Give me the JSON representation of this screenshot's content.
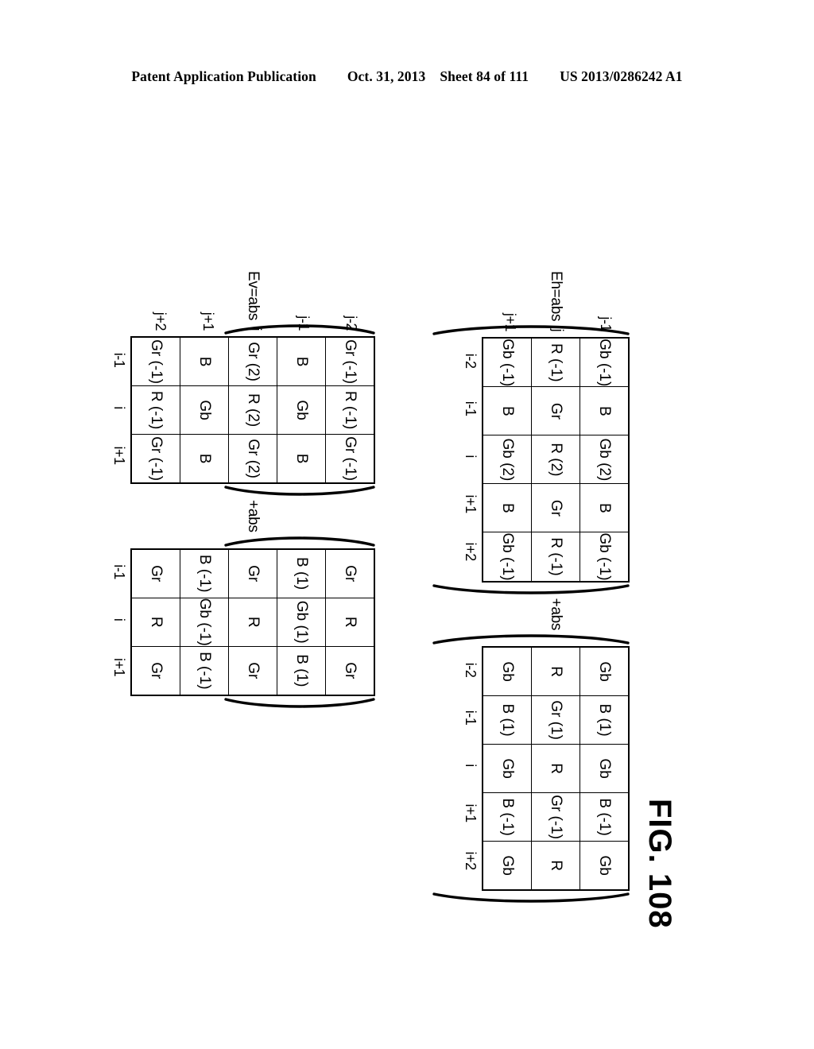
{
  "header": {
    "publication": "Patent Application Publication",
    "date": "Oct. 31, 2013",
    "sheet": "Sheet 84 of 111",
    "patent_number": "US 2013/0286242 A1"
  },
  "figure": {
    "label": "FIG. 108"
  },
  "equations": [
    {
      "id": "eh",
      "lead": "Eh=abs",
      "joiner": "+abs",
      "open_paren": "(",
      "close_paren": ")",
      "terms": [
        {
          "id": "eh-term-1",
          "row_labels": [
            "j-1",
            "j",
            "j+1"
          ],
          "col_labels": [
            "i-2",
            "i-1",
            "i",
            "i+1",
            "i+2"
          ],
          "cells": [
            [
              {
                "channel": "Gb",
                "coef": "(-1)"
              },
              {
                "channel": "B",
                "coef": ""
              },
              {
                "channel": "Gb",
                "coef": "(2)"
              },
              {
                "channel": "B",
                "coef": ""
              },
              {
                "channel": "Gb",
                "coef": "(-1)"
              }
            ],
            [
              {
                "channel": "R",
                "coef": "(-1)"
              },
              {
                "channel": "Gr",
                "coef": ""
              },
              {
                "channel": "R",
                "coef": "(2)"
              },
              {
                "channel": "Gr",
                "coef": ""
              },
              {
                "channel": "R",
                "coef": "(-1)"
              }
            ],
            [
              {
                "channel": "Gb",
                "coef": "(-1)"
              },
              {
                "channel": "B",
                "coef": ""
              },
              {
                "channel": "Gb",
                "coef": "(2)"
              },
              {
                "channel": "B",
                "coef": ""
              },
              {
                "channel": "Gb",
                "coef": "(-1)"
              }
            ]
          ]
        },
        {
          "id": "eh-term-2",
          "row_labels": [
            "j-1",
            "j",
            "j+1"
          ],
          "col_labels": [
            "i-2",
            "i-1",
            "i",
            "i+1",
            "i+2"
          ],
          "cells": [
            [
              {
                "channel": "Gb",
                "coef": ""
              },
              {
                "channel": "B",
                "coef": "(1)"
              },
              {
                "channel": "Gb",
                "coef": ""
              },
              {
                "channel": "B",
                "coef": "(-1)"
              },
              {
                "channel": "Gb",
                "coef": ""
              }
            ],
            [
              {
                "channel": "R",
                "coef": ""
              },
              {
                "channel": "Gr",
                "coef": "(1)"
              },
              {
                "channel": "R",
                "coef": ""
              },
              {
                "channel": "Gr",
                "coef": "(-1)"
              },
              {
                "channel": "R",
                "coef": ""
              }
            ],
            [
              {
                "channel": "Gb",
                "coef": ""
              },
              {
                "channel": "B",
                "coef": "(1)"
              },
              {
                "channel": "Gb",
                "coef": ""
              },
              {
                "channel": "B",
                "coef": "(-1)"
              },
              {
                "channel": "Gb",
                "coef": ""
              }
            ]
          ]
        }
      ]
    },
    {
      "id": "ev",
      "lead": "Ev=abs",
      "joiner": "+abs",
      "open_paren": "(",
      "close_paren": ")",
      "terms": [
        {
          "id": "ev-term-1",
          "row_labels": [
            "j-2",
            "j-1",
            "j",
            "j+1",
            "j+2"
          ],
          "col_labels": [
            "i-1",
            "i",
            "i+1"
          ],
          "cells": [
            [
              {
                "channel": "Gr",
                "coef": "(-1)"
              },
              {
                "channel": "R",
                "coef": "(-1)"
              },
              {
                "channel": "Gr",
                "coef": "(-1)"
              }
            ],
            [
              {
                "channel": "B",
                "coef": ""
              },
              {
                "channel": "Gb",
                "coef": ""
              },
              {
                "channel": "B",
                "coef": ""
              }
            ],
            [
              {
                "channel": "Gr",
                "coef": "(2)"
              },
              {
                "channel": "R",
                "coef": "(2)"
              },
              {
                "channel": "Gr",
                "coef": "(2)"
              }
            ],
            [
              {
                "channel": "B",
                "coef": ""
              },
              {
                "channel": "Gb",
                "coef": ""
              },
              {
                "channel": "B",
                "coef": ""
              }
            ],
            [
              {
                "channel": "Gr",
                "coef": "(-1)"
              },
              {
                "channel": "R",
                "coef": "(-1)"
              },
              {
                "channel": "Gr",
                "coef": "(-1)"
              }
            ]
          ]
        },
        {
          "id": "ev-term-2",
          "row_labels": [
            "j-2",
            "j-1",
            "j",
            "j+1",
            "j+2"
          ],
          "col_labels": [
            "i-1",
            "i",
            "i+1"
          ],
          "cells": [
            [
              {
                "channel": "Gr",
                "coef": ""
              },
              {
                "channel": "R",
                "coef": ""
              },
              {
                "channel": "Gr",
                "coef": ""
              }
            ],
            [
              {
                "channel": "B",
                "coef": "(1)"
              },
              {
                "channel": "Gb",
                "coef": "(1)"
              },
              {
                "channel": "B",
                "coef": "(1)"
              }
            ],
            [
              {
                "channel": "Gr",
                "coef": ""
              },
              {
                "channel": "R",
                "coef": ""
              },
              {
                "channel": "Gr",
                "coef": ""
              }
            ],
            [
              {
                "channel": "B",
                "coef": "(-1)"
              },
              {
                "channel": "Gb",
                "coef": "(-1)"
              },
              {
                "channel": "B",
                "coef": "(-1)"
              }
            ],
            [
              {
                "channel": "Gr",
                "coef": ""
              },
              {
                "channel": "R",
                "coef": ""
              },
              {
                "channel": "Gr",
                "coef": ""
              }
            ]
          ]
        }
      ]
    }
  ]
}
